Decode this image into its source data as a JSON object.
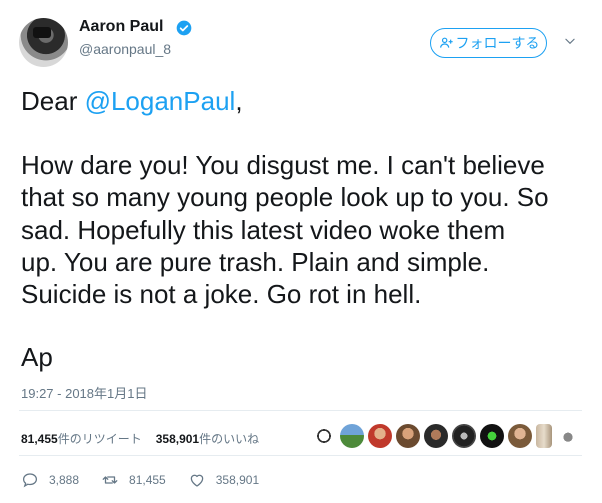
{
  "author": {
    "name": "Aaron Paul",
    "handle": "@aaronpaul_8"
  },
  "follow_button": {
    "label": "フォローする"
  },
  "tweet": {
    "greeting_prefix": "Dear ",
    "mention": "@LoganPaul",
    "greeting_suffix": ",",
    "lines": [
      "How dare you! You disgust me. I can't believe",
      "that so many young people look up to you. So",
      "sad. Hopefully this latest video woke them",
      "up. You are pure trash. Plain and simple.",
      "Suicide is not a joke. Go rot in hell."
    ],
    "signature": "Ap"
  },
  "timestamp": "19:27 - 2018年1月1日",
  "stats": {
    "retweets_count": "81,455",
    "retweets_label": "件のリツイート",
    "likes_count": "358,901",
    "likes_label": "件のいいね"
  },
  "actions": {
    "reply_count": "3,888",
    "retweet_count": "81,455",
    "like_count": "358,901"
  },
  "colors": {
    "accent": "#1da1f2",
    "muted": "#657786",
    "text": "#14171a"
  }
}
